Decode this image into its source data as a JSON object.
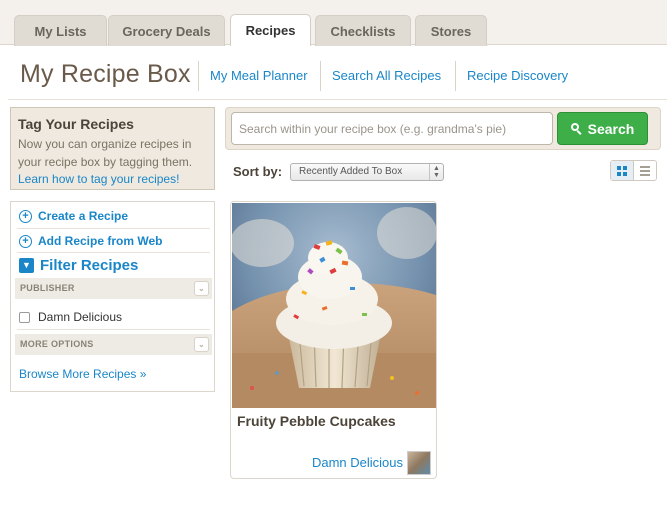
{
  "tabs": [
    "My Lists",
    "Grocery Deals",
    "Recipes",
    "Checklists",
    "Stores"
  ],
  "active_tab": "Recipes",
  "header": {
    "title": "My Recipe Box",
    "nav": [
      "My Meal Planner",
      "Search All Recipes",
      "Recipe Discovery"
    ]
  },
  "tag_box": {
    "title": "Tag Your Recipes",
    "description": "Now you can organize recipes in your recipe box by tagging them.",
    "link": "Learn how to tag your recipes!"
  },
  "sidebar": {
    "create": "Create a Recipe",
    "add_web": "Add Recipe from Web",
    "filter": "Filter Recipes",
    "publisher_head": "PUBLISHER",
    "publisher_option": "Damn Delicious",
    "more_head": "MORE OPTIONS",
    "browse": "Browse More Recipes »"
  },
  "search": {
    "placeholder": "Search within your recipe box (e.g. grandma's pie)",
    "button": "Search"
  },
  "sort": {
    "label": "Sort by:",
    "selected": "Recently Added To Box"
  },
  "recipes": [
    {
      "title": "Fruity Pebble Cupcakes",
      "publisher": "Damn Delicious"
    }
  ],
  "colors": {
    "link": "#1a86c8",
    "search_button": "#3eae49",
    "title_brown": "#6a5a4a"
  }
}
